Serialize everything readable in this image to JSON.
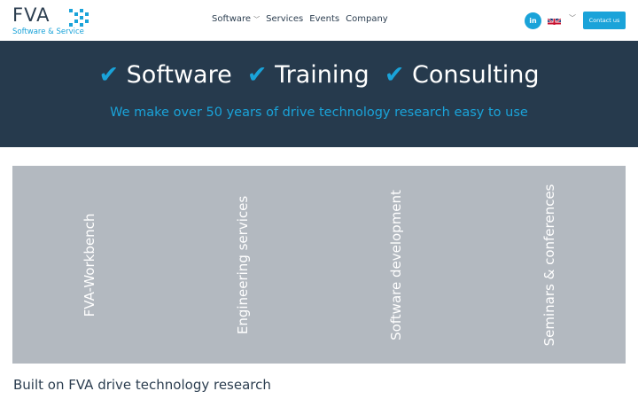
{
  "logo": {
    "word": "FVA",
    "tagline": "Software & Service"
  },
  "nav": {
    "items": [
      {
        "label": "Software",
        "has_dropdown": true
      },
      {
        "label": "Services",
        "has_dropdown": false
      },
      {
        "label": "Events",
        "has_dropdown": false
      },
      {
        "label": "Company",
        "has_dropdown": false
      }
    ]
  },
  "header": {
    "linkedin_label": "in",
    "language": "English (United Kingdom flag)",
    "contact_label": "Contact us"
  },
  "hero": {
    "items": [
      "Software",
      "Training",
      "Consulting"
    ],
    "check_mark": "✔",
    "subtitle": "We make over 50 years of drive technology research easy to use"
  },
  "tiles": [
    {
      "label": "FVA-Workbench"
    },
    {
      "label": "Engineering services"
    },
    {
      "label": "Software development"
    },
    {
      "label": "Seminars & conferences"
    }
  ],
  "section": {
    "heading": "Built on FVA drive technology research"
  },
  "colors": {
    "accent": "#1aa3d9",
    "hero_bg": "#263a4d",
    "tile_bg": "#b3b9c0",
    "text_dark": "#2c3e50"
  }
}
